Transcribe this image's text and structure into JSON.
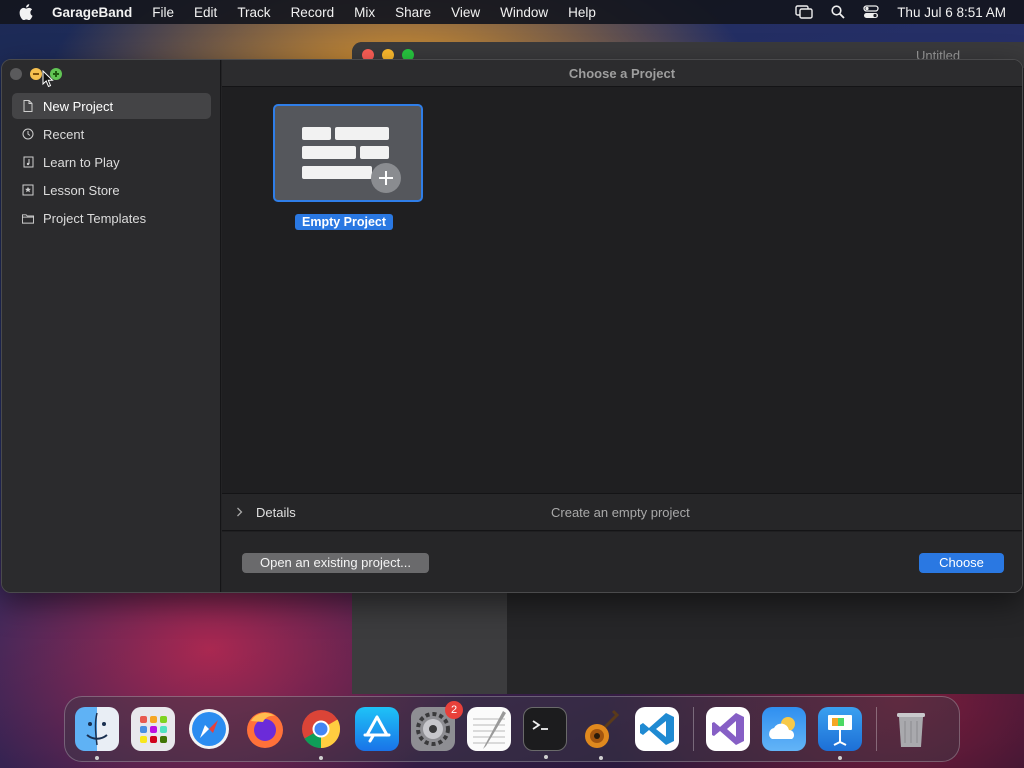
{
  "menubar": {
    "app_name": "GarageBand",
    "items": [
      "File",
      "Edit",
      "Track",
      "Record",
      "Mix",
      "Share",
      "View",
      "Window",
      "Help"
    ],
    "clock": "Thu Jul 6  8:51 AM"
  },
  "background_window": {
    "title": "Untitled"
  },
  "dialog": {
    "title": "Choose a Project",
    "sidebar": [
      {
        "label": "New Project",
        "icon": "document-icon",
        "selected": true
      },
      {
        "label": "Recent",
        "icon": "clock-icon"
      },
      {
        "label": "Learn to Play",
        "icon": "music-book-icon"
      },
      {
        "label": "Lesson Store",
        "icon": "star-icon"
      },
      {
        "label": "Project Templates",
        "icon": "folder-icon"
      }
    ],
    "templates": [
      {
        "label": "Empty Project",
        "selected": true
      }
    ],
    "details_label": "Details",
    "details_description": "Create an empty project",
    "open_existing_label": "Open an existing project...",
    "choose_label": "Choose",
    "accent_color": "#2a78e2"
  },
  "dock": {
    "apps": [
      "Finder",
      "Launchpad",
      "Safari",
      "Firefox",
      "Chrome",
      "App Store",
      "System Settings",
      "TextEdit",
      "Terminal",
      "GarageBand",
      "Visual Studio Code",
      "Visual Studio",
      "Weather",
      "Keynote",
      "Trash"
    ],
    "system_settings_badge": "2"
  }
}
